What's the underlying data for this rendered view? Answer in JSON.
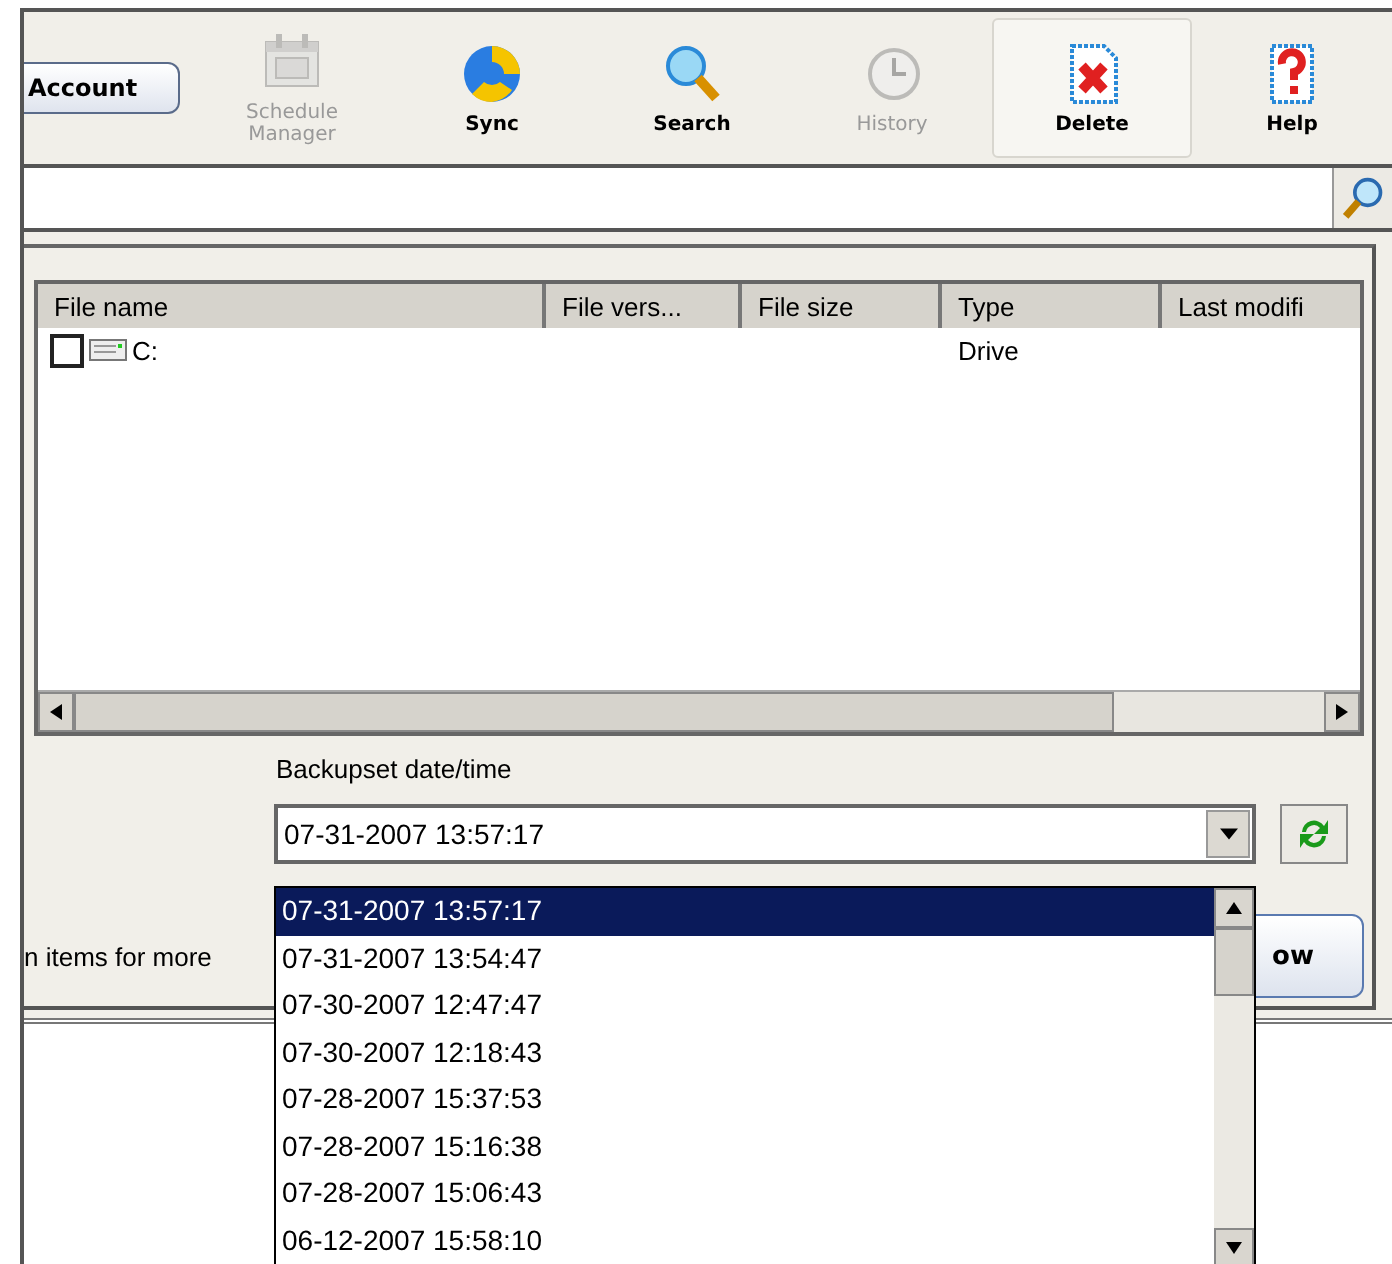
{
  "toolbar": {
    "account_button": "Account",
    "items": [
      {
        "label": "Schedule Manager",
        "disabled": true,
        "pressed": false
      },
      {
        "label": "Sync",
        "disabled": false,
        "pressed": false
      },
      {
        "label": "Search",
        "disabled": false,
        "pressed": false
      },
      {
        "label": "History",
        "disabled": true,
        "pressed": false
      },
      {
        "label": "Delete",
        "disabled": false,
        "pressed": true
      },
      {
        "label": "Help",
        "disabled": false,
        "pressed": false
      }
    ]
  },
  "file_table": {
    "columns": [
      "File name",
      "File vers...",
      "File size",
      "Type",
      "Last modifi"
    ],
    "rows": [
      {
        "name": "C:",
        "type": "Drive",
        "checked": false
      }
    ]
  },
  "backupset": {
    "label": "Backupset date/time",
    "value": "07-31-2007 13:57:17",
    "options": [
      {
        "text": "07-31-2007 13:57:17",
        "selected": true
      },
      {
        "text": "07-31-2007 13:54:47",
        "selected": false
      },
      {
        "text": "07-30-2007 12:47:47",
        "selected": false
      },
      {
        "text": "07-30-2007 12:18:43",
        "selected": false
      },
      {
        "text": "07-28-2007 15:37:53",
        "selected": false
      },
      {
        "text": "07-28-2007 15:16:38",
        "selected": false
      },
      {
        "text": "07-28-2007 15:06:43",
        "selected": false
      },
      {
        "text": "06-12-2007 15:58:10",
        "selected": false
      }
    ]
  },
  "hint": "n items for more",
  "action_button": "ow"
}
